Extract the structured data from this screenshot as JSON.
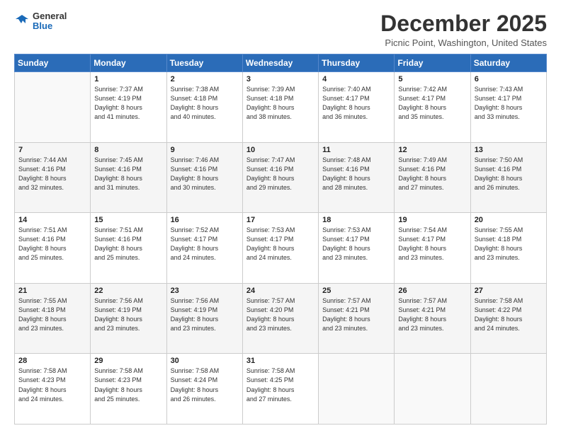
{
  "logo": {
    "general": "General",
    "blue": "Blue"
  },
  "title": "December 2025",
  "subtitle": "Picnic Point, Washington, United States",
  "days_of_week": [
    "Sunday",
    "Monday",
    "Tuesday",
    "Wednesday",
    "Thursday",
    "Friday",
    "Saturday"
  ],
  "weeks": [
    [
      {
        "day": "",
        "info": ""
      },
      {
        "day": "1",
        "info": "Sunrise: 7:37 AM\nSunset: 4:19 PM\nDaylight: 8 hours\nand 41 minutes."
      },
      {
        "day": "2",
        "info": "Sunrise: 7:38 AM\nSunset: 4:18 PM\nDaylight: 8 hours\nand 40 minutes."
      },
      {
        "day": "3",
        "info": "Sunrise: 7:39 AM\nSunset: 4:18 PM\nDaylight: 8 hours\nand 38 minutes."
      },
      {
        "day": "4",
        "info": "Sunrise: 7:40 AM\nSunset: 4:17 PM\nDaylight: 8 hours\nand 36 minutes."
      },
      {
        "day": "5",
        "info": "Sunrise: 7:42 AM\nSunset: 4:17 PM\nDaylight: 8 hours\nand 35 minutes."
      },
      {
        "day": "6",
        "info": "Sunrise: 7:43 AM\nSunset: 4:17 PM\nDaylight: 8 hours\nand 33 minutes."
      }
    ],
    [
      {
        "day": "7",
        "info": "Sunrise: 7:44 AM\nSunset: 4:16 PM\nDaylight: 8 hours\nand 32 minutes."
      },
      {
        "day": "8",
        "info": "Sunrise: 7:45 AM\nSunset: 4:16 PM\nDaylight: 8 hours\nand 31 minutes."
      },
      {
        "day": "9",
        "info": "Sunrise: 7:46 AM\nSunset: 4:16 PM\nDaylight: 8 hours\nand 30 minutes."
      },
      {
        "day": "10",
        "info": "Sunrise: 7:47 AM\nSunset: 4:16 PM\nDaylight: 8 hours\nand 29 minutes."
      },
      {
        "day": "11",
        "info": "Sunrise: 7:48 AM\nSunset: 4:16 PM\nDaylight: 8 hours\nand 28 minutes."
      },
      {
        "day": "12",
        "info": "Sunrise: 7:49 AM\nSunset: 4:16 PM\nDaylight: 8 hours\nand 27 minutes."
      },
      {
        "day": "13",
        "info": "Sunrise: 7:50 AM\nSunset: 4:16 PM\nDaylight: 8 hours\nand 26 minutes."
      }
    ],
    [
      {
        "day": "14",
        "info": "Sunrise: 7:51 AM\nSunset: 4:16 PM\nDaylight: 8 hours\nand 25 minutes."
      },
      {
        "day": "15",
        "info": "Sunrise: 7:51 AM\nSunset: 4:16 PM\nDaylight: 8 hours\nand 25 minutes."
      },
      {
        "day": "16",
        "info": "Sunrise: 7:52 AM\nSunset: 4:17 PM\nDaylight: 8 hours\nand 24 minutes."
      },
      {
        "day": "17",
        "info": "Sunrise: 7:53 AM\nSunset: 4:17 PM\nDaylight: 8 hours\nand 24 minutes."
      },
      {
        "day": "18",
        "info": "Sunrise: 7:53 AM\nSunset: 4:17 PM\nDaylight: 8 hours\nand 23 minutes."
      },
      {
        "day": "19",
        "info": "Sunrise: 7:54 AM\nSunset: 4:17 PM\nDaylight: 8 hours\nand 23 minutes."
      },
      {
        "day": "20",
        "info": "Sunrise: 7:55 AM\nSunset: 4:18 PM\nDaylight: 8 hours\nand 23 minutes."
      }
    ],
    [
      {
        "day": "21",
        "info": "Sunrise: 7:55 AM\nSunset: 4:18 PM\nDaylight: 8 hours\nand 23 minutes."
      },
      {
        "day": "22",
        "info": "Sunrise: 7:56 AM\nSunset: 4:19 PM\nDaylight: 8 hours\nand 23 minutes."
      },
      {
        "day": "23",
        "info": "Sunrise: 7:56 AM\nSunset: 4:19 PM\nDaylight: 8 hours\nand 23 minutes."
      },
      {
        "day": "24",
        "info": "Sunrise: 7:57 AM\nSunset: 4:20 PM\nDaylight: 8 hours\nand 23 minutes."
      },
      {
        "day": "25",
        "info": "Sunrise: 7:57 AM\nSunset: 4:21 PM\nDaylight: 8 hours\nand 23 minutes."
      },
      {
        "day": "26",
        "info": "Sunrise: 7:57 AM\nSunset: 4:21 PM\nDaylight: 8 hours\nand 23 minutes."
      },
      {
        "day": "27",
        "info": "Sunrise: 7:58 AM\nSunset: 4:22 PM\nDaylight: 8 hours\nand 24 minutes."
      }
    ],
    [
      {
        "day": "28",
        "info": "Sunrise: 7:58 AM\nSunset: 4:23 PM\nDaylight: 8 hours\nand 24 minutes."
      },
      {
        "day": "29",
        "info": "Sunrise: 7:58 AM\nSunset: 4:23 PM\nDaylight: 8 hours\nand 25 minutes."
      },
      {
        "day": "30",
        "info": "Sunrise: 7:58 AM\nSunset: 4:24 PM\nDaylight: 8 hours\nand 26 minutes."
      },
      {
        "day": "31",
        "info": "Sunrise: 7:58 AM\nSunset: 4:25 PM\nDaylight: 8 hours\nand 27 minutes."
      },
      {
        "day": "",
        "info": ""
      },
      {
        "day": "",
        "info": ""
      },
      {
        "day": "",
        "info": ""
      }
    ]
  ]
}
